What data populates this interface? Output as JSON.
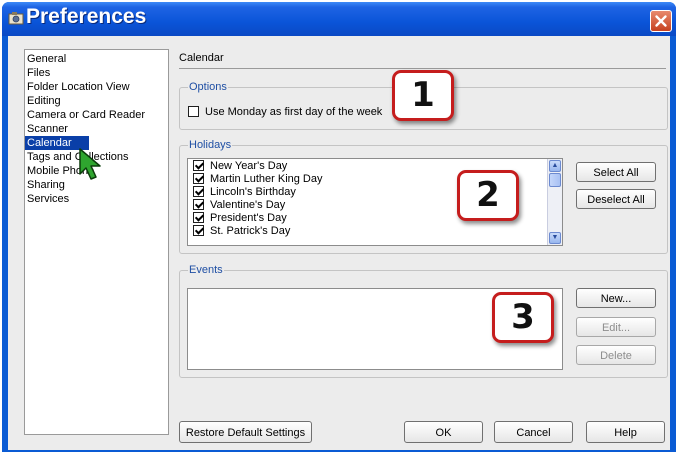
{
  "window": {
    "title": "Preferences"
  },
  "sidebar": {
    "items": [
      {
        "label": "General",
        "selected": false
      },
      {
        "label": "Files",
        "selected": false
      },
      {
        "label": "Folder Location View",
        "selected": false
      },
      {
        "label": "Editing",
        "selected": false
      },
      {
        "label": "Camera or Card Reader",
        "selected": false
      },
      {
        "label": "Scanner",
        "selected": false
      },
      {
        "label": "Calendar",
        "selected": true
      },
      {
        "label": "Tags and Collections",
        "selected": false
      },
      {
        "label": "Mobile Phone",
        "selected": false
      },
      {
        "label": "Sharing",
        "selected": false
      },
      {
        "label": "Services",
        "selected": false
      }
    ]
  },
  "section": {
    "title": "Calendar"
  },
  "options": {
    "label": "Options",
    "monday_first": {
      "label": "Use Monday as first day of the week",
      "checked": false
    }
  },
  "holidays": {
    "label": "Holidays",
    "items": [
      {
        "label": "New Year's Day",
        "checked": true
      },
      {
        "label": "Martin Luther King Day",
        "checked": true
      },
      {
        "label": "Lincoln's Birthday",
        "checked": true
      },
      {
        "label": "Valentine's Day",
        "checked": true
      },
      {
        "label": "President's Day",
        "checked": true
      },
      {
        "label": "St. Patrick's Day",
        "checked": true
      }
    ],
    "select_all": "Select All",
    "deselect_all": "Deselect All"
  },
  "events": {
    "label": "Events",
    "new": "New...",
    "edit": "Edit...",
    "delete": "Delete"
  },
  "footer": {
    "restore": "Restore Default Settings",
    "ok": "OK",
    "cancel": "Cancel",
    "help": "Help"
  },
  "callouts": [
    "1",
    "2",
    "3"
  ],
  "colors": {
    "titlebar": "#0a54d8",
    "selection": "#0a3fa8",
    "group_label": "#1f4fa4",
    "callout_border": "#c51d1d"
  }
}
